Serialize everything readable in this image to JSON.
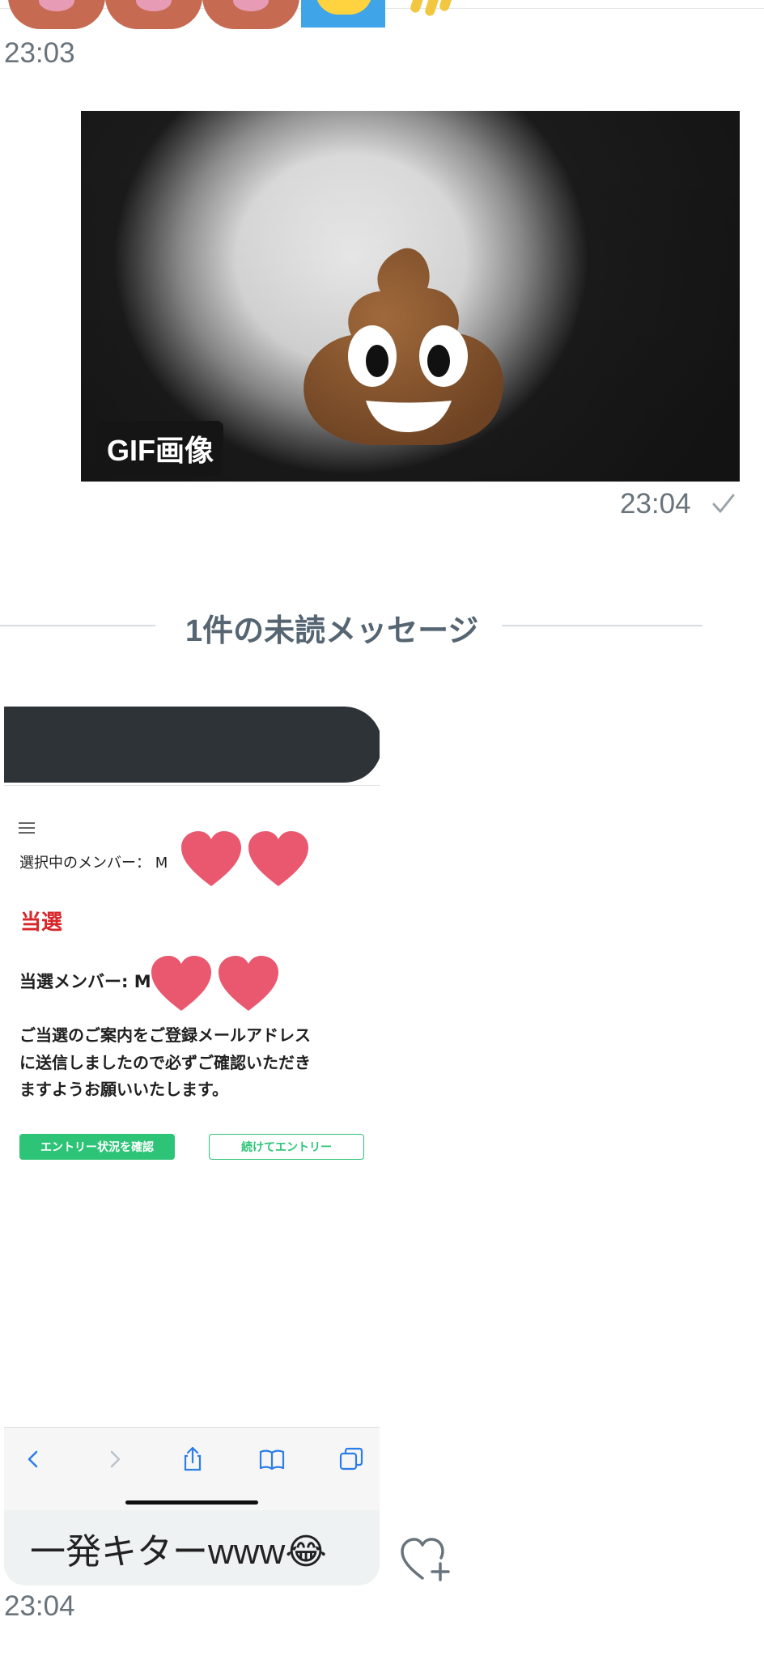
{
  "messages": [
    {
      "id": "prev",
      "time": "23:03"
    },
    {
      "id": "gif",
      "badge": "GIF画像",
      "time": "23:04",
      "status_icon": "check-icon"
    },
    {
      "id": "received",
      "caption": "一発キターwww😂",
      "time": "23:04"
    }
  ],
  "divider": {
    "label": "1件の未読メッセージ"
  },
  "screenshot_content": {
    "member_label": "選択中のメンバー： M",
    "result_heading": "当選",
    "winning_label": "当選メンバー: M",
    "notice_lines": [
      "ご当選のご案内をご登録メールアドレス",
      "に送信しましたので必ずご確認いただき",
      "ますようお願いいたします。"
    ],
    "primary_button": "エントリー状況を確認",
    "secondary_button": "続けてエントリー",
    "browser_icons": [
      "back-icon",
      "forward-icon",
      "share-icon",
      "bookmarks-icon",
      "tabs-icon"
    ]
  },
  "colors": {
    "time_text": "#69737b",
    "divider_text": "#556571",
    "accent_green": "#2ec477",
    "heading_red": "#d8262a",
    "heart": "#e9586f"
  },
  "icons": {
    "reaction": "heart-plus-icon"
  }
}
